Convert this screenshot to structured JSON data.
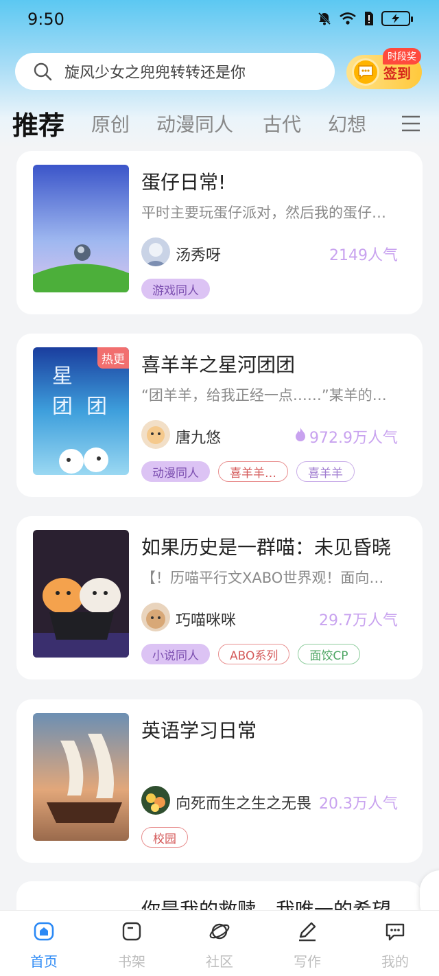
{
  "status_bar": {
    "time": "9:50"
  },
  "search": {
    "text": "旋风少女之兜兜转转还是你"
  },
  "checkin": {
    "label": "签到",
    "badge": "时段奖"
  },
  "tabs": [
    "推荐",
    "原创",
    "动漫同人",
    "古代",
    "幻想"
  ],
  "books": [
    {
      "title": "蛋仔日常!",
      "desc": "平时主要玩蛋仔派对，然后我的蛋仔…",
      "author": "汤秀呀",
      "popularity": "2149人气",
      "hot": false,
      "tags": [
        {
          "label": "游戏同人",
          "style": "purple"
        }
      ]
    },
    {
      "title": "喜羊羊之星河团团",
      "desc": "“团羊羊，给我正经一点……”某羊的…",
      "author": "唐九悠",
      "popularity": "972.9万人气",
      "hot": true,
      "hot_label": "热更",
      "tags": [
        {
          "label": "动漫同人",
          "style": "purple"
        },
        {
          "label": "喜羊羊…",
          "style": "red"
        },
        {
          "label": "喜羊羊",
          "style": "lav"
        }
      ]
    },
    {
      "title": "如果历史是一群喵：未见昏晓",
      "desc": "【！历喵平行文XABO世界观！面向…",
      "author": "巧喵咪咪",
      "popularity": "29.7万人气",
      "hot": false,
      "tags": [
        {
          "label": "小说同人",
          "style": "purple"
        },
        {
          "label": "ABO系列",
          "style": "red"
        },
        {
          "label": "面饺CP",
          "style": "green"
        }
      ]
    },
    {
      "title": "英语学习日常",
      "desc": "",
      "author": "向死而生之生之无畏",
      "popularity": "20.3万人气",
      "hot": false,
      "tags": [
        {
          "label": "校园",
          "style": "red"
        }
      ]
    }
  ],
  "partial_book": {
    "title": "你是我的救赎，我唯一的希望"
  },
  "bottom_nav": [
    {
      "label": "首页",
      "icon": "home-icon",
      "active": true
    },
    {
      "label": "书架",
      "icon": "bookshelf-icon",
      "active": false
    },
    {
      "label": "社区",
      "icon": "planet-icon",
      "active": false
    },
    {
      "label": "写作",
      "icon": "pen-icon",
      "active": false
    },
    {
      "label": "我的",
      "icon": "profile-chat-icon",
      "active": false
    }
  ],
  "colors": {
    "accent_blue": "#2b89f5",
    "popularity_purple": "#c8a2ef",
    "hot_red": "#f16f6f"
  }
}
